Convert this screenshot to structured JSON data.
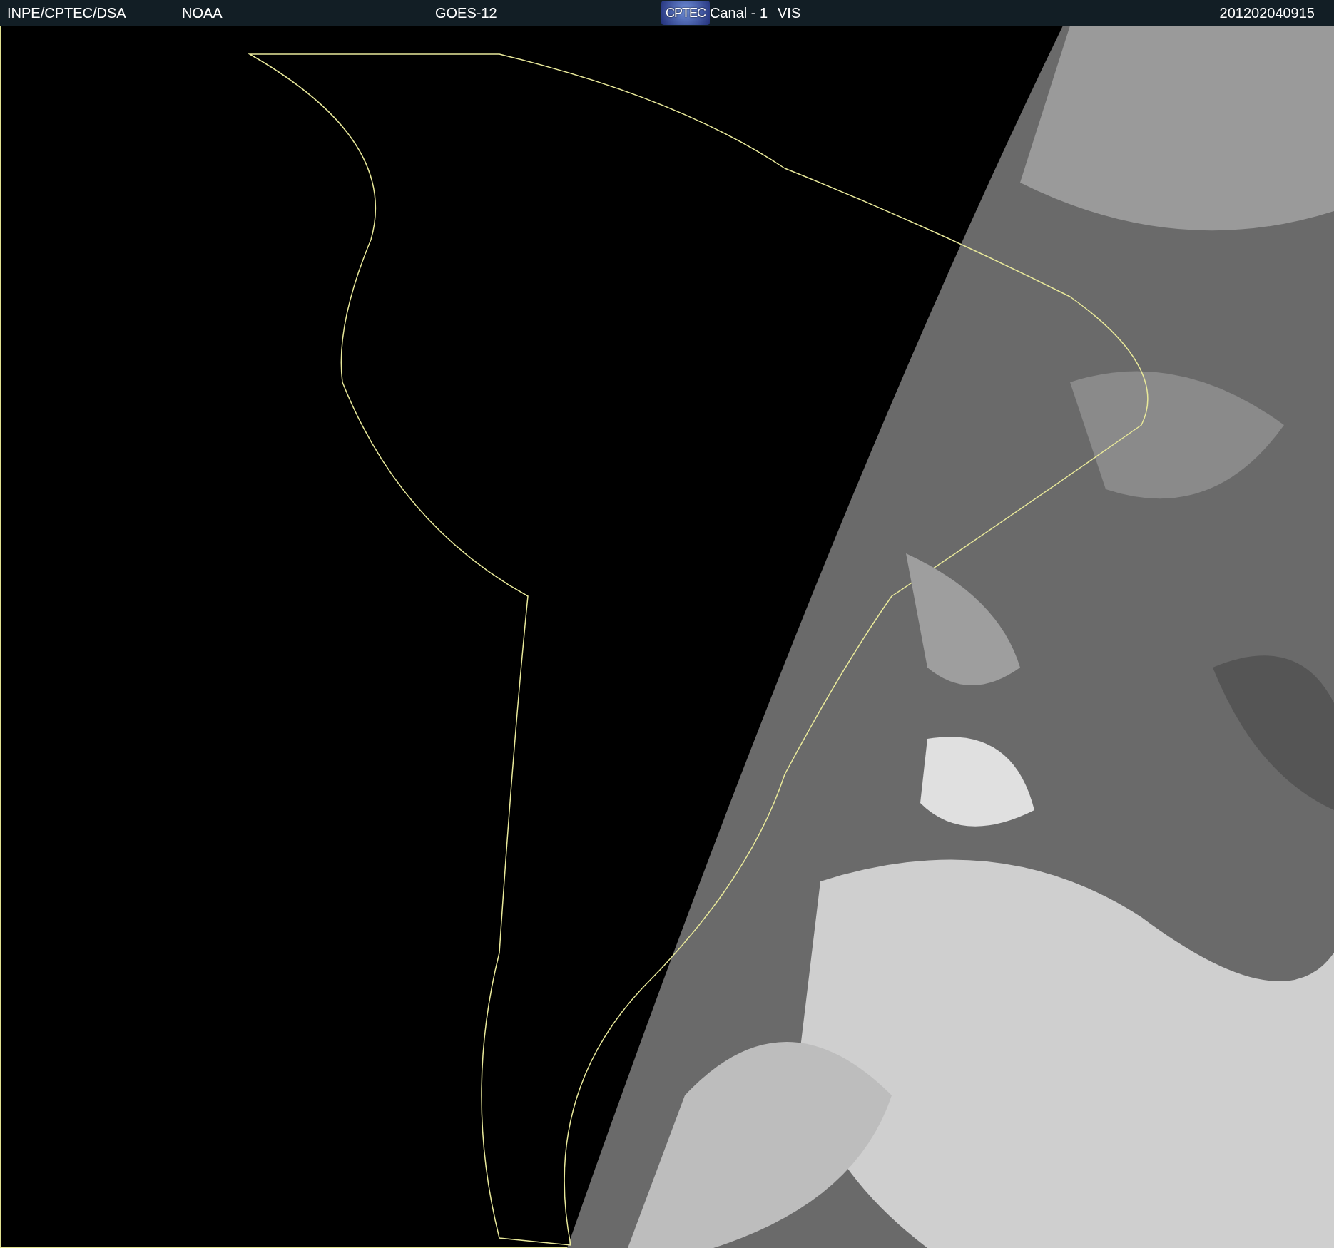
{
  "header": {
    "source": "INPE/CPTEC/DSA",
    "agency": "NOAA",
    "satellite": "GOES-12",
    "logo": "CPTEC",
    "channel": "Canal - 1",
    "band": "VIS",
    "timestamp": "201202040915"
  }
}
